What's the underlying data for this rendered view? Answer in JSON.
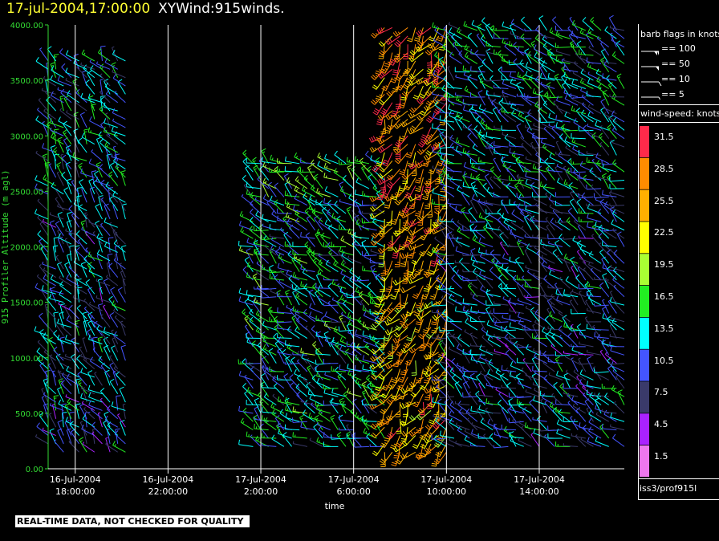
{
  "header": {
    "date_time": "17-jul-2004,17:00:00",
    "product": "XYWind:915winds."
  },
  "warning": "REAL-TIME DATA, NOT CHECKED FOR QUALITY",
  "source": "iss3/prof915l",
  "barb_legend": {
    "title": "barb flags in knots",
    "items": [
      {
        "label": "== 100",
        "value": 100
      },
      {
        "label": "== 50",
        "value": 50
      },
      {
        "label": "== 10",
        "value": 10
      },
      {
        "label": "== 5",
        "value": 5
      }
    ]
  },
  "speed_legend": {
    "title": "wind-speed: knots",
    "bins": [
      {
        "label": "31.5",
        "color": "#ff2a4a"
      },
      {
        "label": "28.5",
        "color": "#ff8c00"
      },
      {
        "label": "25.5",
        "color": "#ffb000"
      },
      {
        "label": "22.5",
        "color": "#ffff00"
      },
      {
        "label": "19.5",
        "color": "#aaff33"
      },
      {
        "label": "16.5",
        "color": "#22ee22"
      },
      {
        "label": "13.5",
        "color": "#00ffff"
      },
      {
        "label": "10.5",
        "color": "#4455ff"
      },
      {
        "label": "7.5",
        "color": "#3a3a6a"
      },
      {
        "label": "4.5",
        "color": "#aa22ff"
      },
      {
        "label": "1.5",
        "color": "#ee77ee"
      }
    ]
  },
  "chart_data": {
    "type": "scatter",
    "title": "XYWind:915winds.",
    "xlabel": "time",
    "ylabel": "915 Profiler Altitude (m agl)",
    "ylim": [
      0,
      4000
    ],
    "xlim": [
      "2004-07-16 16:50",
      "2004-07-17 17:40"
    ],
    "grid": "vertical lines at x ticks",
    "y_ticks": [
      "0.00",
      "500.00",
      "1000.00",
      "1500.00",
      "2000.00",
      "2500.00",
      "3000.00",
      "3500.00",
      "4000.00"
    ],
    "x_ticks": [
      {
        "date": "16-Jul-2004",
        "time": "18:00:00"
      },
      {
        "date": "16-Jul-2004",
        "time": "22:00:00"
      },
      {
        "date": "17-Jul-2004",
        "time": "2:00:00"
      },
      {
        "date": "17-Jul-2004",
        "time": "6:00:00"
      },
      {
        "date": "17-Jul-2004",
        "time": "10:00:00"
      },
      {
        "date": "17-Jul-2004",
        "time": "14:00:00"
      }
    ],
    "profile_groups": [
      {
        "start": "2004-07-16 16:50",
        "end": "2004-07-16 20:10",
        "alt_min": 150,
        "alt_max": 3700,
        "dominant_speed_knots": 10.5,
        "direction_deg": 320
      },
      {
        "start": "2004-07-17 01:40",
        "end": "2004-07-17 07:20",
        "alt_min": 200,
        "alt_max": 2800,
        "dominant_speed_knots": 13.5,
        "direction_deg": 300
      },
      {
        "start": "2004-07-17 07:20",
        "end": "2004-07-17 10:00",
        "alt_min": 150,
        "alt_max": 4000,
        "dominant_speed_knots": 25.5,
        "direction_deg": 210
      },
      {
        "start": "2004-07-17 10:00",
        "end": "2004-07-17 17:40",
        "alt_min": 200,
        "alt_max": 4000,
        "dominant_speed_knots": 10.5,
        "direction_deg": 300
      }
    ]
  }
}
